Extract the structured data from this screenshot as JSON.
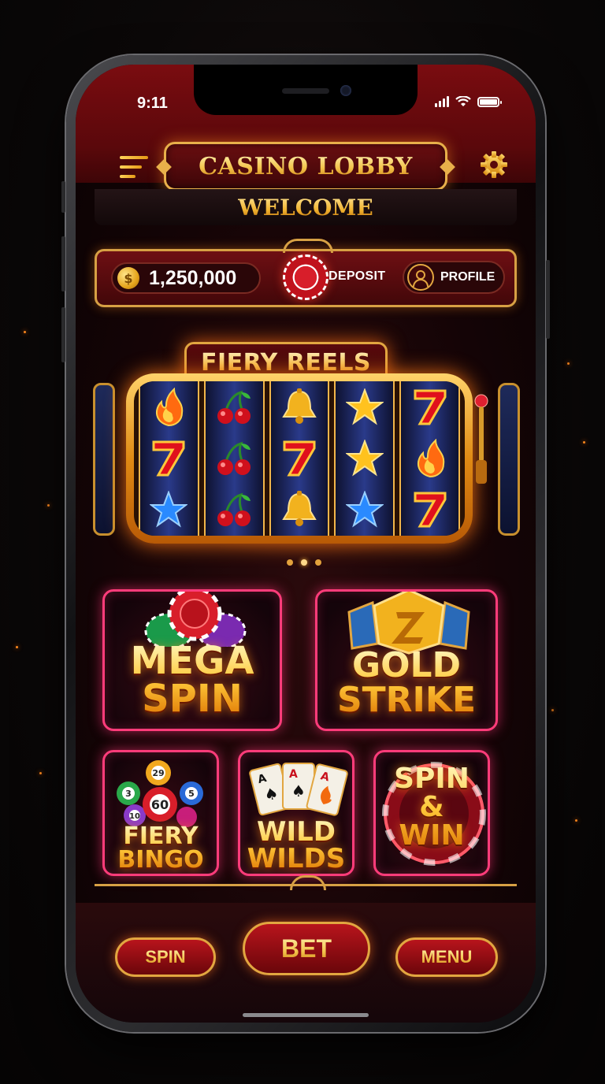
{
  "status": {
    "time": "9:11",
    "battery_level": 1.0
  },
  "header": {
    "title": "CASINO LOBBY",
    "menu_icon": "hamburger-menu-icon",
    "settings_icon": "gear-icon",
    "welcome": "WELCOME"
  },
  "balance": {
    "coin_icon": "coin-icon",
    "amount": "1,250,000",
    "deposit_label": "DEPOSIT",
    "profile_label": "PROFILE"
  },
  "featured": {
    "title": "FIERY REELS",
    "reels": [
      [
        "flame",
        "cherry",
        "bell",
        "star",
        "seven"
      ],
      [
        "seven",
        "cherry",
        "seven",
        "star",
        "flame"
      ],
      [
        "star",
        "cherry",
        "bell",
        "star",
        "seven"
      ]
    ],
    "page_count": 3,
    "active_page": 1
  },
  "games": [
    {
      "title": "MEGA\nSPIN",
      "art": "poker-chips"
    },
    {
      "title": "GOLD\nSTRIKE",
      "art": "gold-emblem"
    },
    {
      "title": "FIERY\nBINGO",
      "art": "bingo-balls",
      "balls": [
        "29",
        "3",
        "5",
        "60",
        "10"
      ]
    },
    {
      "title": "WILD\nWILDS",
      "art": "playing-cards",
      "cards": [
        "A",
        "A",
        "A"
      ]
    },
    {
      "title": "SPIN\n&\nWIN",
      "art": "casino-chip"
    }
  ],
  "bottom": {
    "spin_label": "SPIN",
    "bet_label": "BET",
    "menu_label": "MENU"
  },
  "colors": {
    "gold": "#e2a640",
    "crimson": "#7a0c10",
    "neon_pink": "#ff3c7a"
  }
}
